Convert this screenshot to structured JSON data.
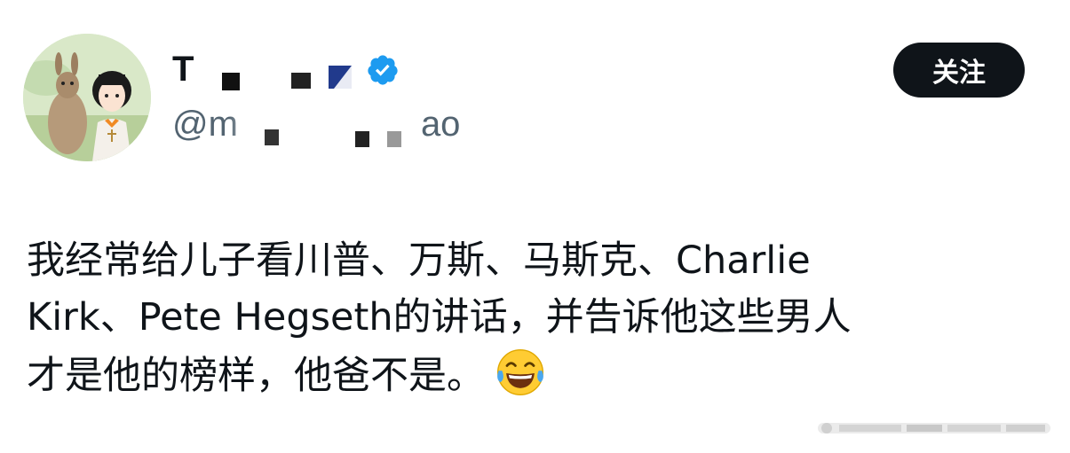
{
  "user": {
    "display_name": "T",
    "handle": "@m",
    "handle_tail": "ao",
    "verified_icon": "verified-badge-icon",
    "verified_color": "#1d9bf0"
  },
  "follow_button": {
    "label": "关注"
  },
  "tweet": {
    "line1": "我经常给儿子看川普、万斯、马斯克、Charlie",
    "line2": "Kirk、Pete Hegseth的讲话，并告诉他这些男人",
    "line3": "才是他的榜样，他爸不是。",
    "emoji": "laughing-with-tears-emoji"
  },
  "colors": {
    "text": "#0f1419",
    "secondary": "#536471",
    "button_bg": "#0f1419"
  }
}
